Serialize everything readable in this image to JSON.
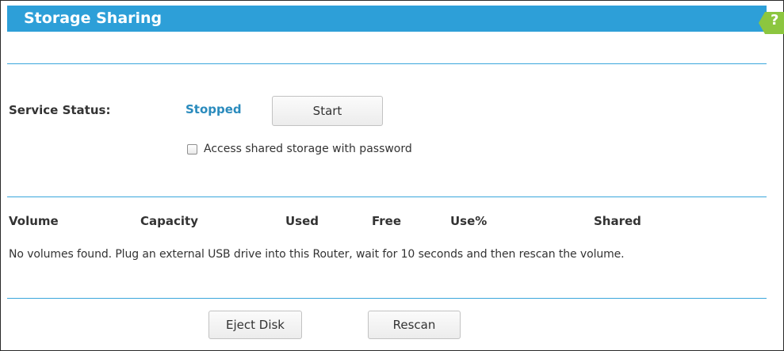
{
  "header": {
    "title": "Storage Sharing",
    "help_label": "?"
  },
  "service": {
    "status_label": "Service Status:",
    "status_value": "Stopped",
    "start_label": "Start",
    "password_checkbox_label": "Access shared storage with password",
    "password_checkbox_checked": false
  },
  "volumes": {
    "columns": [
      "Volume",
      "Capacity",
      "Used",
      "Free",
      "Use%",
      "Shared"
    ],
    "empty_message": "No volumes found. Plug an external USB drive into this Router, wait for 10 seconds and then rescan the volume."
  },
  "actions": {
    "eject_label": "Eject Disk",
    "rescan_label": "Rescan"
  },
  "colors": {
    "accent": "#2d9fd8",
    "help_badge": "#8cc63f",
    "status_text": "#2a8bbd"
  }
}
